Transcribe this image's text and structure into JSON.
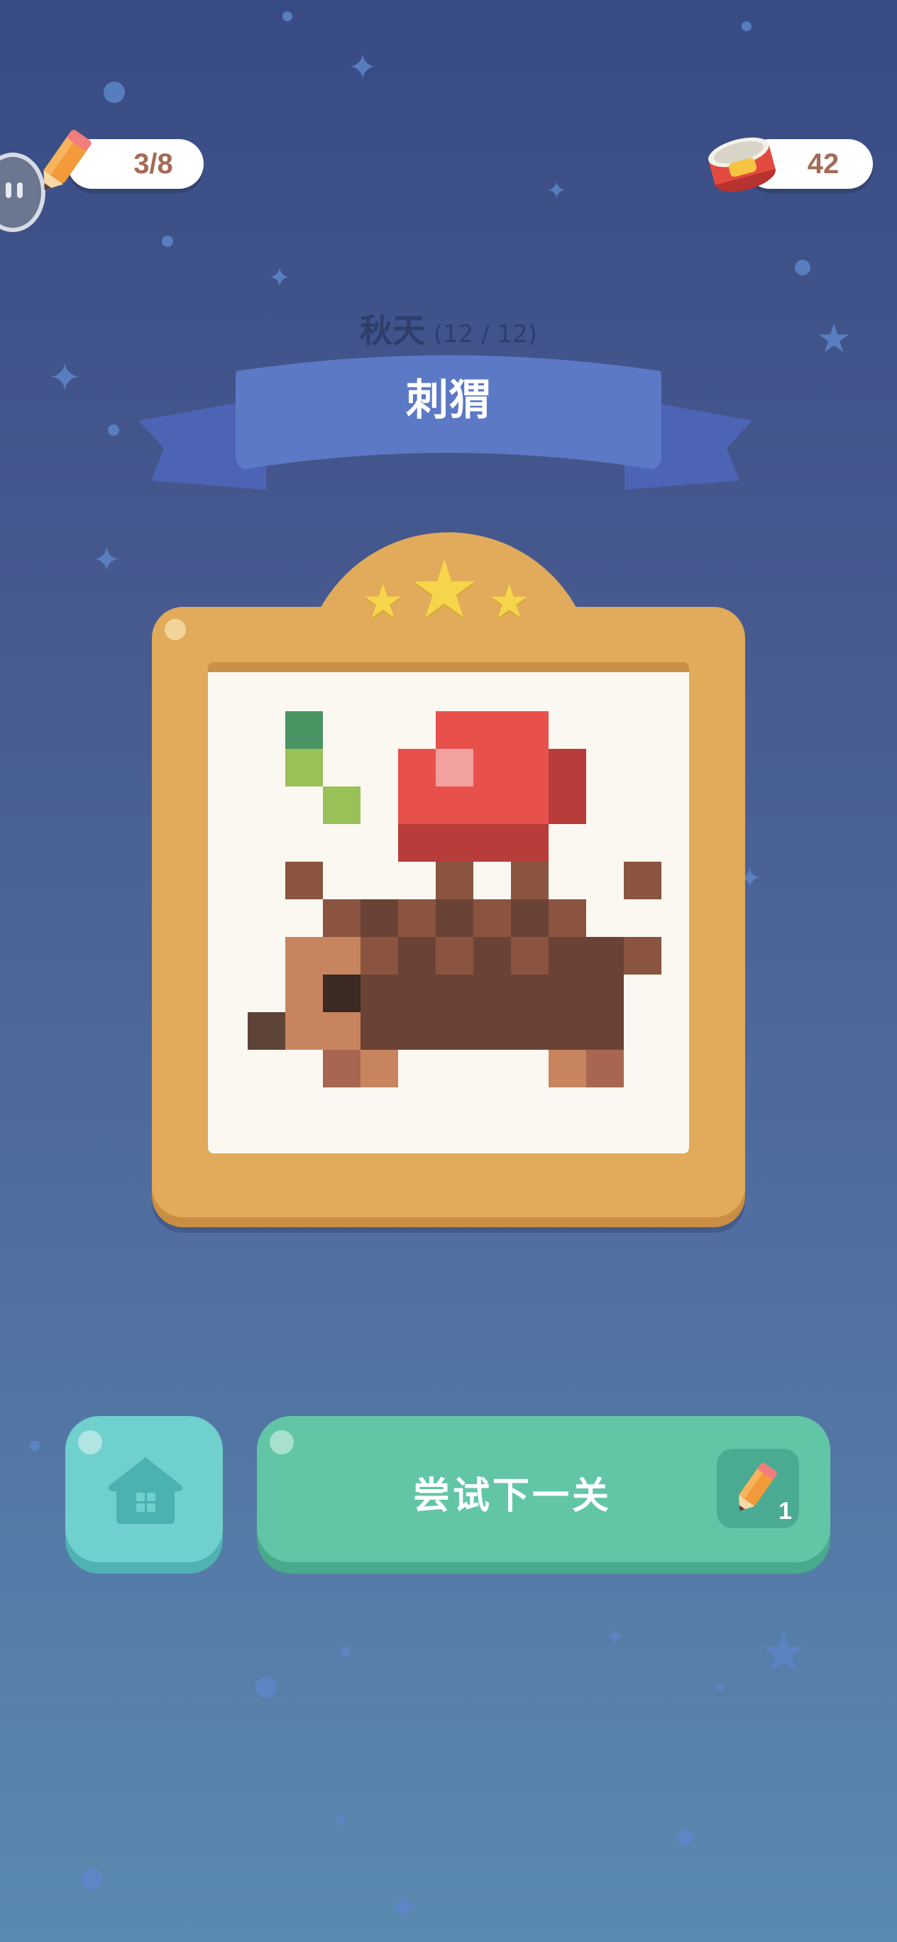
{
  "hud": {
    "pencils": "3/8",
    "coins": "42"
  },
  "level": {
    "season": "秋天",
    "progress": "(12 / 12)",
    "title": "刺猬"
  },
  "rating": {
    "stars": 3,
    "max_stars": 3
  },
  "buttons": {
    "home_icon": "home-icon",
    "next_label": "尝试下一关",
    "next_cost": "1"
  },
  "colors": {
    "frame": "#e1ab5b",
    "home_button": "#6fd0cd",
    "next_button": "#62c6a6",
    "ribbon": "#5c79c6"
  },
  "pixel_art": {
    "subject": "hedgehog carrying apple",
    "palette": {
      "G": "#4a9463",
      "L": "#99c157",
      "R": "#e8514b",
      "P": "#f2a0a0",
      "D": "#b83c3a",
      "B": "#8a5440",
      "K": "#6b4336",
      "S": "#c8845f",
      "E": "#3a2a22",
      "T": "#6b4a3d",
      "F": "#a86650",
      "N": "#5e4436"
    },
    "grid": [
      "..............",
      "..G...RRR.....",
      "..L..RPRRD....",
      "...L.RRRRD....",
      ".....DDDD.....",
      "..B...B.B..B..",
      "...BKBKBKB....",
      "..SSBKBKBKKB..",
      "..SEKKKKKKK...",
      ".NSSKKKKKKK...",
      "...FS....SF...",
      ".............."
    ]
  }
}
